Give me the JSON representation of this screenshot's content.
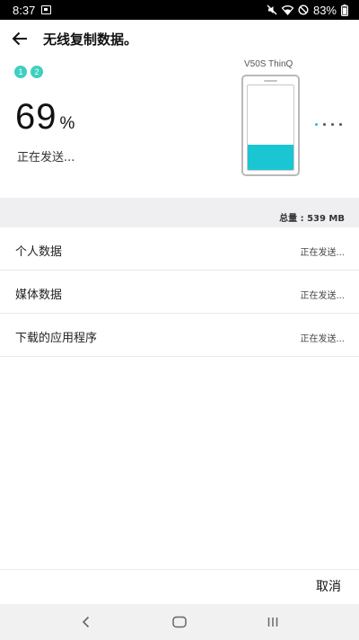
{
  "status_bar": {
    "time": "8:37",
    "battery": "83%",
    "icons": [
      "gallery-icon",
      "mute-icon",
      "wifi-icon",
      "do-not-disturb-icon",
      "battery-icon"
    ]
  },
  "header": {
    "title": "无线复制数据。",
    "back_icon": "arrow-left-icon"
  },
  "progress": {
    "steps": [
      "1",
      "2"
    ],
    "percent": "69",
    "unit": "%",
    "status": "正在发送...",
    "device_name": "V50S ThinQ",
    "device_fill_fraction": 0.3
  },
  "total": {
    "label": "总量 : 539 MB"
  },
  "items": [
    {
      "label": "个人数据",
      "status": "正在发送..."
    },
    {
      "label": "媒体数据",
      "status": "正在发送..."
    },
    {
      "label": "下载的应用程序",
      "status": "正在发送..."
    }
  ],
  "footer": {
    "cancel_label": "取消"
  },
  "nav": {
    "icons": [
      "back-nav-icon",
      "home-icon",
      "recents-icon"
    ]
  },
  "colors": {
    "accent": "#1bc6d3",
    "step": "#3ecfbf",
    "section_bg": "#efeff2"
  }
}
